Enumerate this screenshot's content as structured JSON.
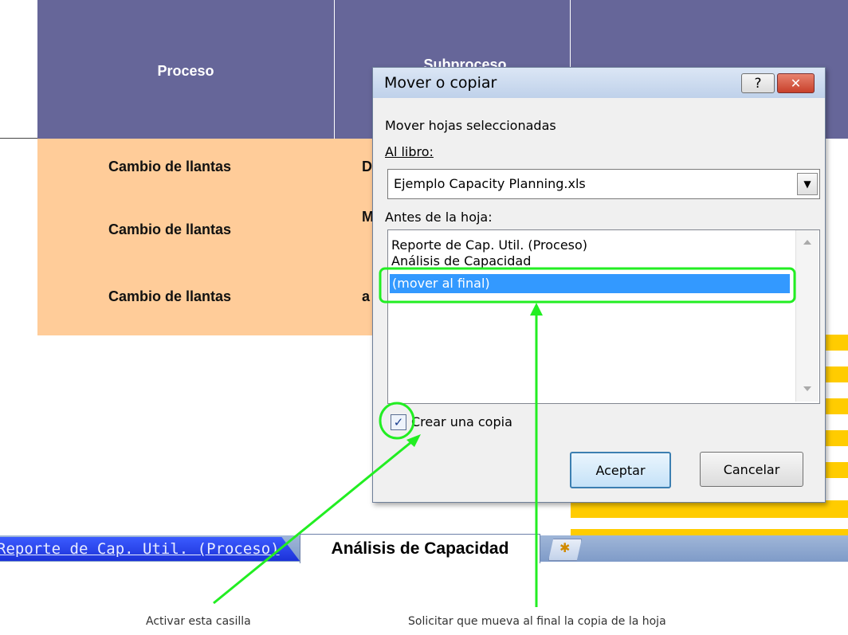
{
  "sheet": {
    "header": {
      "proceso": "Proceso",
      "subproceso": "Subproceso"
    },
    "rows": [
      {
        "proceso": "Cambio de llantas",
        "sub": "D"
      },
      {
        "proceso": "Cambio de llantas",
        "sub": "M"
      },
      {
        "proceso": "Cambio de llantas",
        "sub": "a"
      }
    ],
    "colors": {
      "header_bg": "#666699",
      "row_bg": "#ffcc99",
      "band": "#ffcc00"
    }
  },
  "tabs": {
    "items": [
      "Reporte de Cap. Util. (Proceso)",
      "Análisis de Capacidad"
    ],
    "active": "Análisis de Capacidad",
    "new_sheet_icon": "insert-sheet-icon"
  },
  "dialog": {
    "title": "Mover o copiar",
    "help_label": "?",
    "close_label": "✕",
    "move_label": "Mover hojas seleccionadas",
    "book_label": "Al libro:",
    "book_value": "Ejemplo Capacity Planning.xls",
    "before_label": "Antes de la hoja:",
    "sheets": [
      "Reporte de Cap. Util. (Proceso)",
      "Análisis de Capacidad",
      "(mover al final)"
    ],
    "selected_index": 2,
    "copy_label": "Crear una copia",
    "copy_checked": true,
    "ok_label": "Aceptar",
    "cancel_label": "Cancelar"
  },
  "annotations": {
    "left": "Activar esta casilla",
    "right": "Solicitar que mueva al final la copia de la hoja",
    "color": "#22ee22"
  }
}
